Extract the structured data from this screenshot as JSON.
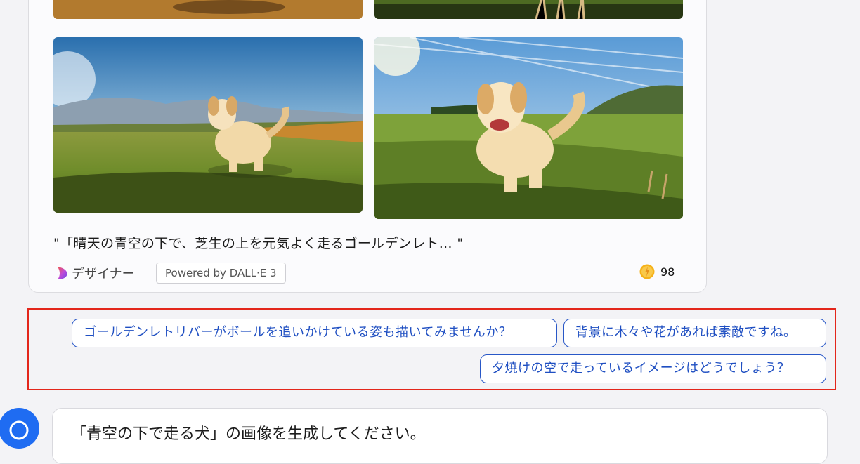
{
  "response_card": {
    "caption": "\"「晴天の青空の下で、芝生の上を元気よく走るゴールデンレト… \"",
    "designer_label": "デザイナー",
    "powered_by": "Powered by DALL·E 3",
    "boost_count": "98"
  },
  "suggestions": [
    {
      "label": "ゴールデンレトリバーがボールを追いかけている姿も描いてみませんか？"
    },
    {
      "label": "背景に木々や花があれば素敵ですね。"
    },
    {
      "label": "夕焼けの空で走っているイメージはどうでしょう？"
    }
  ],
  "user_message": {
    "text": "「青空の下で走る犬」の画像を生成してください。"
  },
  "colors": {
    "accent": "#1f4fc2",
    "highlight_border": "#e3261b",
    "avatar": "#1f6cf2"
  }
}
